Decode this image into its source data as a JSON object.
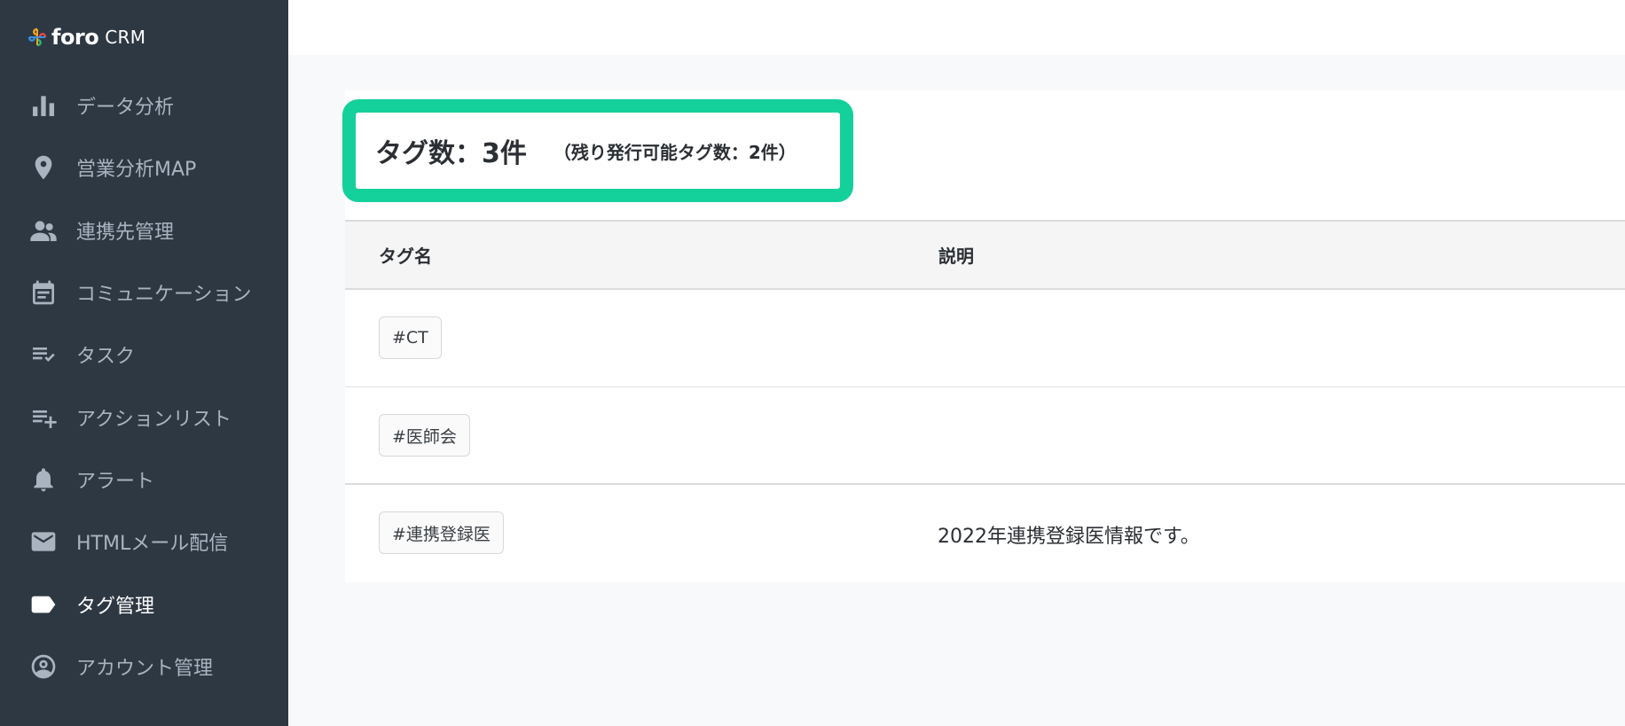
{
  "brand": {
    "name": "foro",
    "suffix": "CRM"
  },
  "sidebar": {
    "items": [
      {
        "label": "データ分析",
        "icon": "bar-chart-icon"
      },
      {
        "label": "営業分析MAP",
        "icon": "map-pin-icon"
      },
      {
        "label": "連携先管理",
        "icon": "people-icon"
      },
      {
        "label": "コミュニケーション",
        "icon": "calendar-note-icon"
      },
      {
        "label": "タスク",
        "icon": "task-list-check-icon"
      },
      {
        "label": "アクションリスト",
        "icon": "list-add-icon"
      },
      {
        "label": "アラート",
        "icon": "bell-icon"
      },
      {
        "label": "HTMLメール配信",
        "icon": "mail-icon"
      },
      {
        "label": "タグ管理",
        "icon": "tag-icon",
        "active": true
      },
      {
        "label": "アカウント管理",
        "icon": "account-circle-icon"
      }
    ]
  },
  "summary": {
    "count_text": "タグ数：3件",
    "remaining_text": "（残り発行可能タグ数：2件）",
    "highlight_color": "#14d09b"
  },
  "table": {
    "headers": {
      "name": "タグ名",
      "description": "説明"
    },
    "rows": [
      {
        "tag": "#CT",
        "description": ""
      },
      {
        "tag": "#医師会",
        "description": ""
      },
      {
        "tag": "#連携登録医",
        "description": "2022年連携登録医情報です。"
      }
    ]
  }
}
